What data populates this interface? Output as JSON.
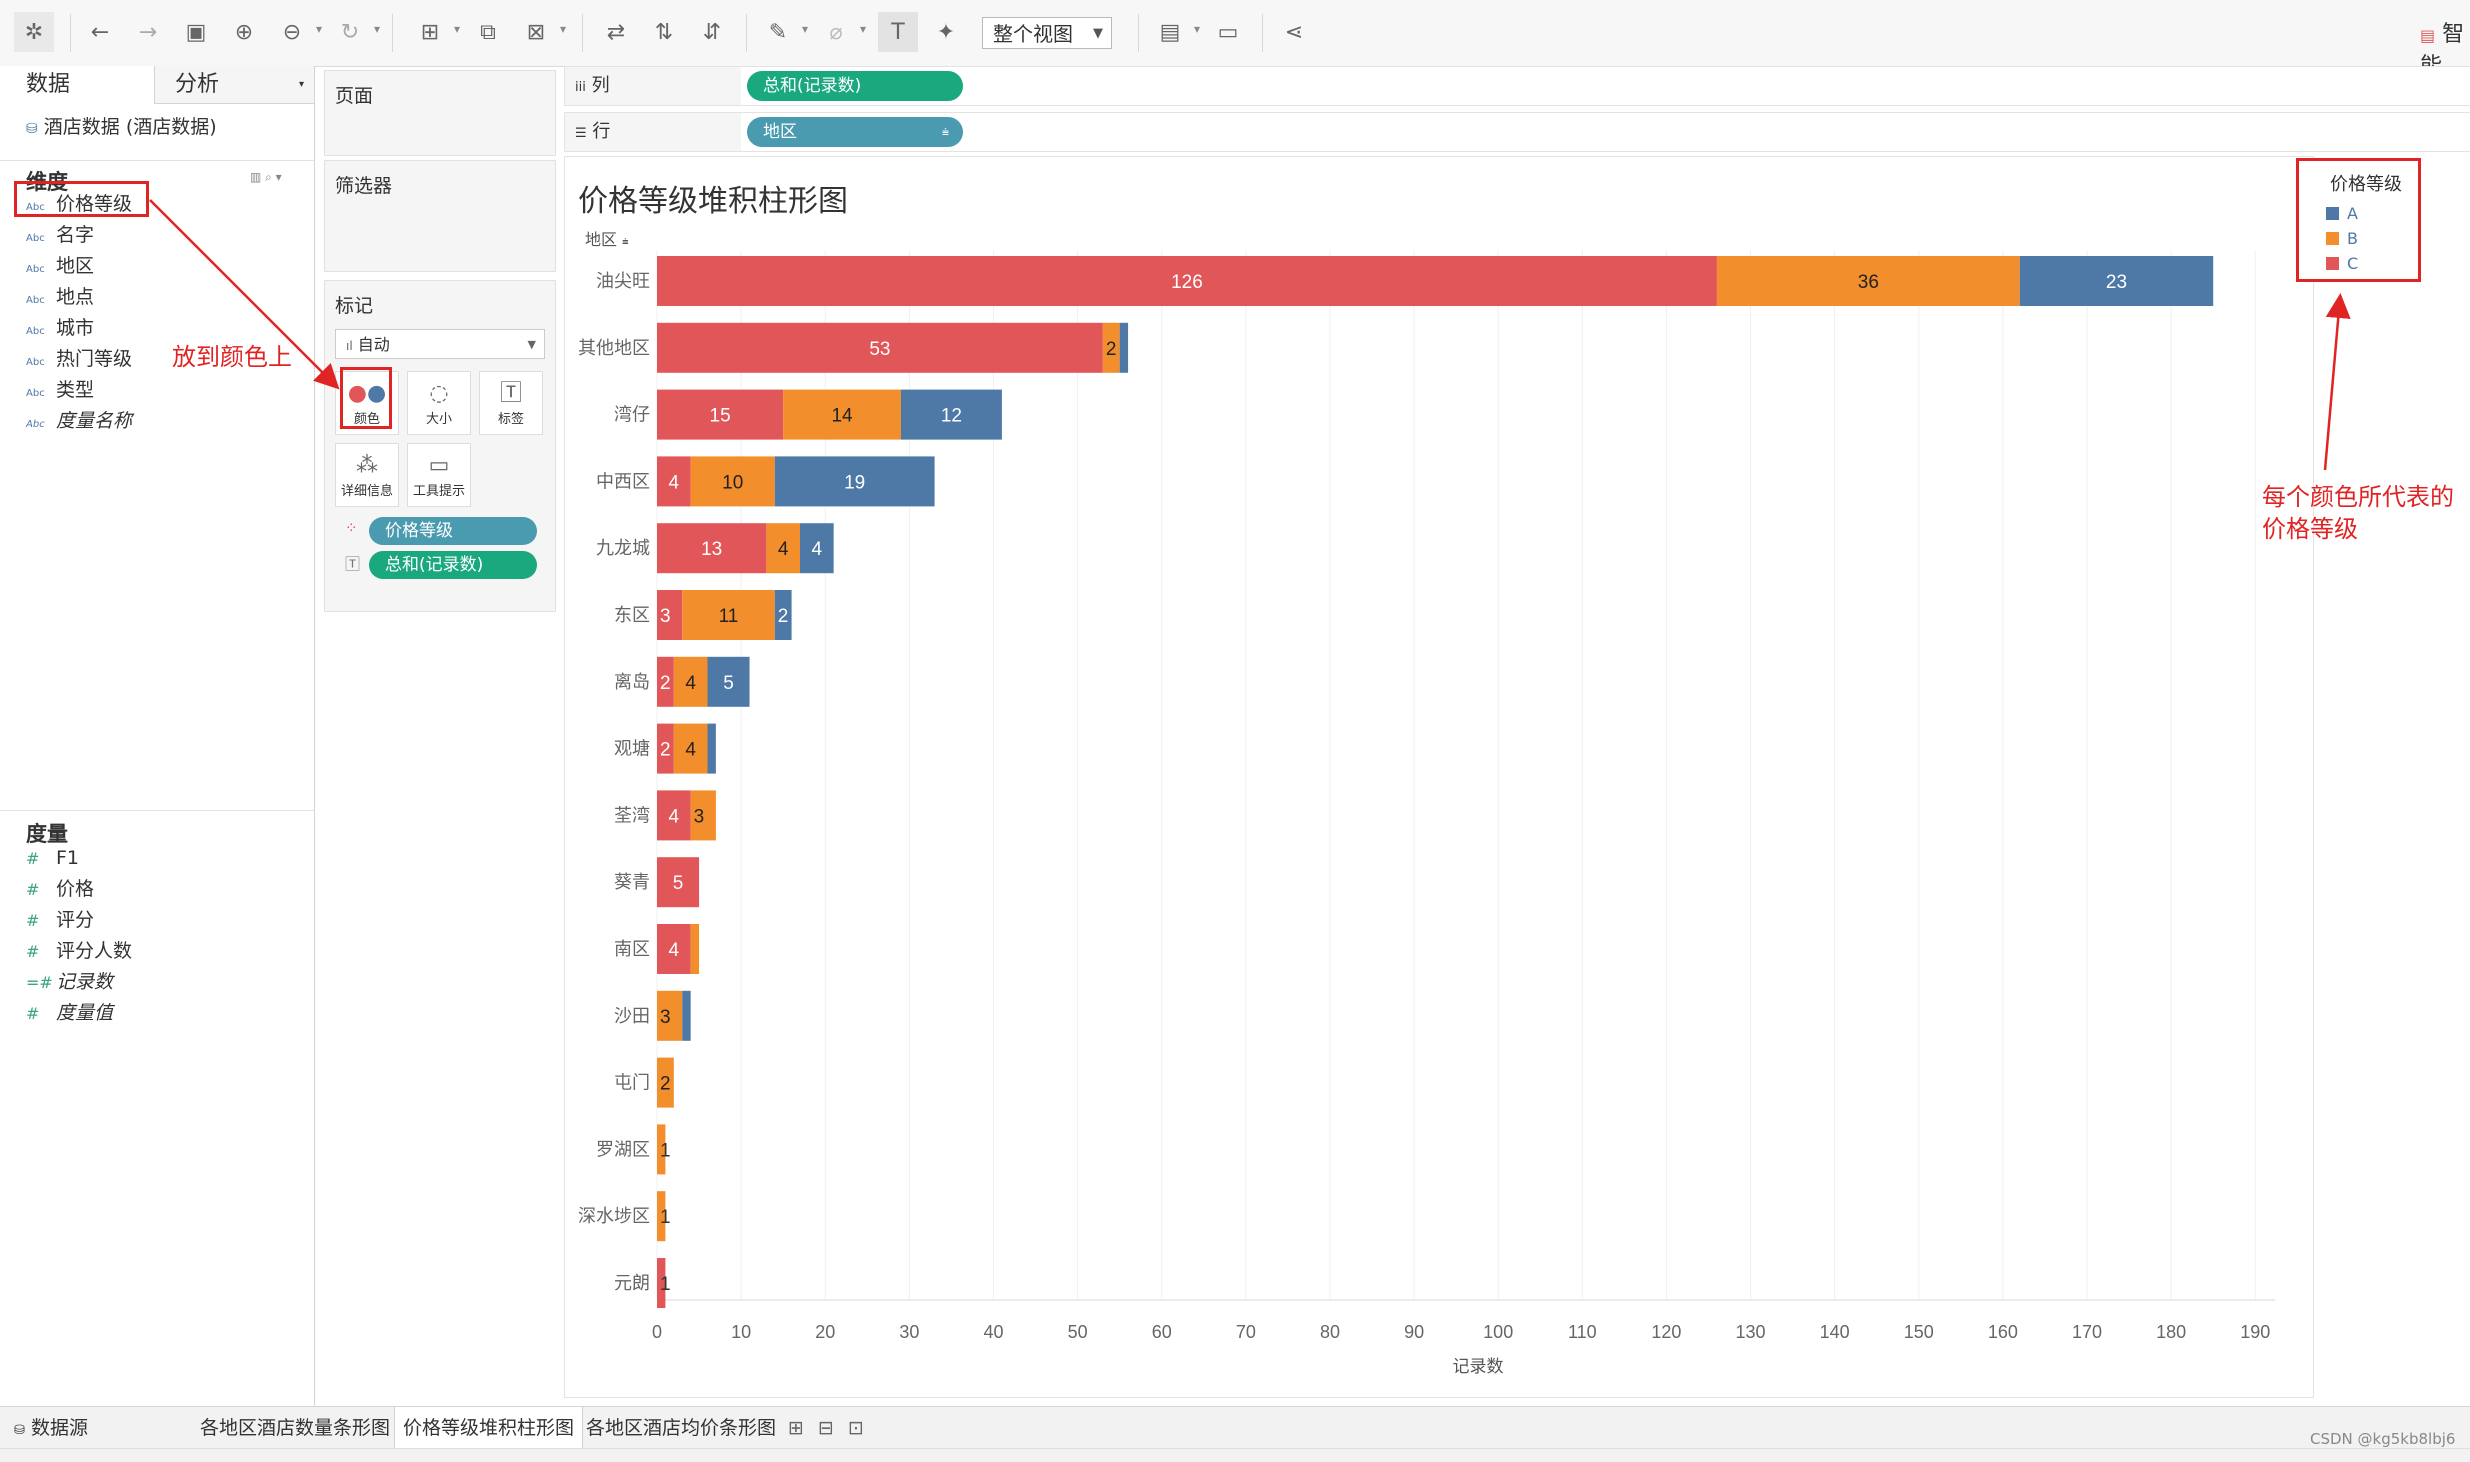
{
  "toolbar": {
    "view_select": "整个视图",
    "brand": "智能"
  },
  "data_pane": {
    "tab_data": "数据",
    "tab_analysis": "分析",
    "datasource": "酒店数据 (酒店数据)",
    "dimensions_title": "维度",
    "dimensions": [
      {
        "type": "Abc",
        "label": "价格等级",
        "italic": false
      },
      {
        "type": "Abc",
        "label": "名字",
        "italic": false
      },
      {
        "type": "Abc",
        "label": "地区",
        "italic": false
      },
      {
        "type": "Abc",
        "label": "地点",
        "italic": false
      },
      {
        "type": "Abc",
        "label": "城市",
        "italic": false
      },
      {
        "type": "Abc",
        "label": "热门等级",
        "italic": false
      },
      {
        "type": "Abc",
        "label": "类型",
        "italic": false
      },
      {
        "type": "Abc",
        "label": "度量名称",
        "italic": true
      }
    ],
    "measures_title": "度量",
    "measures": [
      {
        "label": "F1",
        "italic": false
      },
      {
        "label": "价格",
        "italic": false
      },
      {
        "label": "评分",
        "italic": false
      },
      {
        "label": "评分人数",
        "italic": false
      },
      {
        "label": "记录数",
        "italic": true
      },
      {
        "label": "度量值",
        "italic": true
      }
    ]
  },
  "cards": {
    "pages": "页面",
    "filters": "筛选器",
    "marks": "标记",
    "marks_type": "自动",
    "mark_buttons": [
      "颜色",
      "大小",
      "标签",
      "详细信息",
      "工具提示"
    ],
    "mark_pills": [
      {
        "label": "价格等级",
        "color": "#4a9bb0"
      },
      {
        "label": "总和(记录数)",
        "color": "#1aa97e"
      }
    ]
  },
  "shelves": {
    "columns_label": "列",
    "columns_pill": "总和(记录数)",
    "rows_label": "行",
    "rows_pill": "地区"
  },
  "chart_title": "价格等级堆积柱形图",
  "row_header": "地区",
  "legend": {
    "title": "价格等级",
    "items": [
      {
        "label": "A",
        "color": "#4e79a7"
      },
      {
        "label": "B",
        "color": "#f28e2b"
      },
      {
        "label": "C",
        "color": "#e15759"
      }
    ]
  },
  "chart_data": {
    "type": "bar",
    "orientation": "horizontal",
    "stacked": true,
    "categories": [
      "油尖旺",
      "其他地区",
      "湾仔",
      "中西区",
      "九龙城",
      "东区",
      "离岛",
      "观塘",
      "荃湾",
      "葵青",
      "南区",
      "沙田",
      "屯门",
      "罗湖区",
      "深水埗区",
      "元朗"
    ],
    "series": [
      {
        "name": "C",
        "color": "#e15759",
        "values": [
          126,
          53,
          15,
          4,
          13,
          3,
          2,
          2,
          4,
          5,
          4,
          0,
          0,
          0,
          0,
          1
        ]
      },
      {
        "name": "B",
        "color": "#f28e2b",
        "values": [
          36,
          2,
          14,
          10,
          4,
          11,
          4,
          4,
          3,
          0,
          1,
          3,
          2,
          1,
          1,
          0
        ]
      },
      {
        "name": "A",
        "color": "#4e79a7",
        "values": [
          23,
          1,
          12,
          19,
          4,
          2,
          5,
          1,
          0,
          0,
          0,
          1,
          0,
          0,
          0,
          0
        ]
      }
    ],
    "data_labels": [
      [
        "126",
        "36",
        "23"
      ],
      [
        "53",
        "2",
        ""
      ],
      [
        "15",
        "14",
        "12"
      ],
      [
        "4",
        "10",
        "19"
      ],
      [
        "13",
        "4",
        "4"
      ],
      [
        "3",
        "11",
        "2"
      ],
      [
        "2",
        "4",
        "5"
      ],
      [
        "2",
        "4",
        ""
      ],
      [
        "4",
        "3",
        ""
      ],
      [
        "5",
        "",
        ""
      ],
      [
        "4",
        "",
        ""
      ],
      [
        "",
        "3",
        ""
      ],
      [
        "",
        "2",
        ""
      ],
      [
        "",
        "1",
        ""
      ],
      [
        "",
        "1",
        ""
      ],
      [
        "1",
        "",
        ""
      ]
    ],
    "xlim": [
      0,
      190
    ],
    "xticks": [
      0,
      10,
      20,
      30,
      40,
      50,
      60,
      70,
      80,
      90,
      100,
      110,
      120,
      130,
      140,
      150,
      160,
      170,
      180,
      190
    ],
    "xlabel": "记录数",
    "grid": true
  },
  "annotations": {
    "drag_to_color": "放到颜色上",
    "legend_note_line1": "每个颜色所代表的",
    "legend_note_line2": "价格等级"
  },
  "bottom_tabs": {
    "datasource": "数据源",
    "sheets": [
      "各地区酒店数量条形图",
      "价格等级堆积柱形图",
      "各地区酒店均价条形图"
    ]
  },
  "watermark": "CSDN @kg5kb8lbj6"
}
